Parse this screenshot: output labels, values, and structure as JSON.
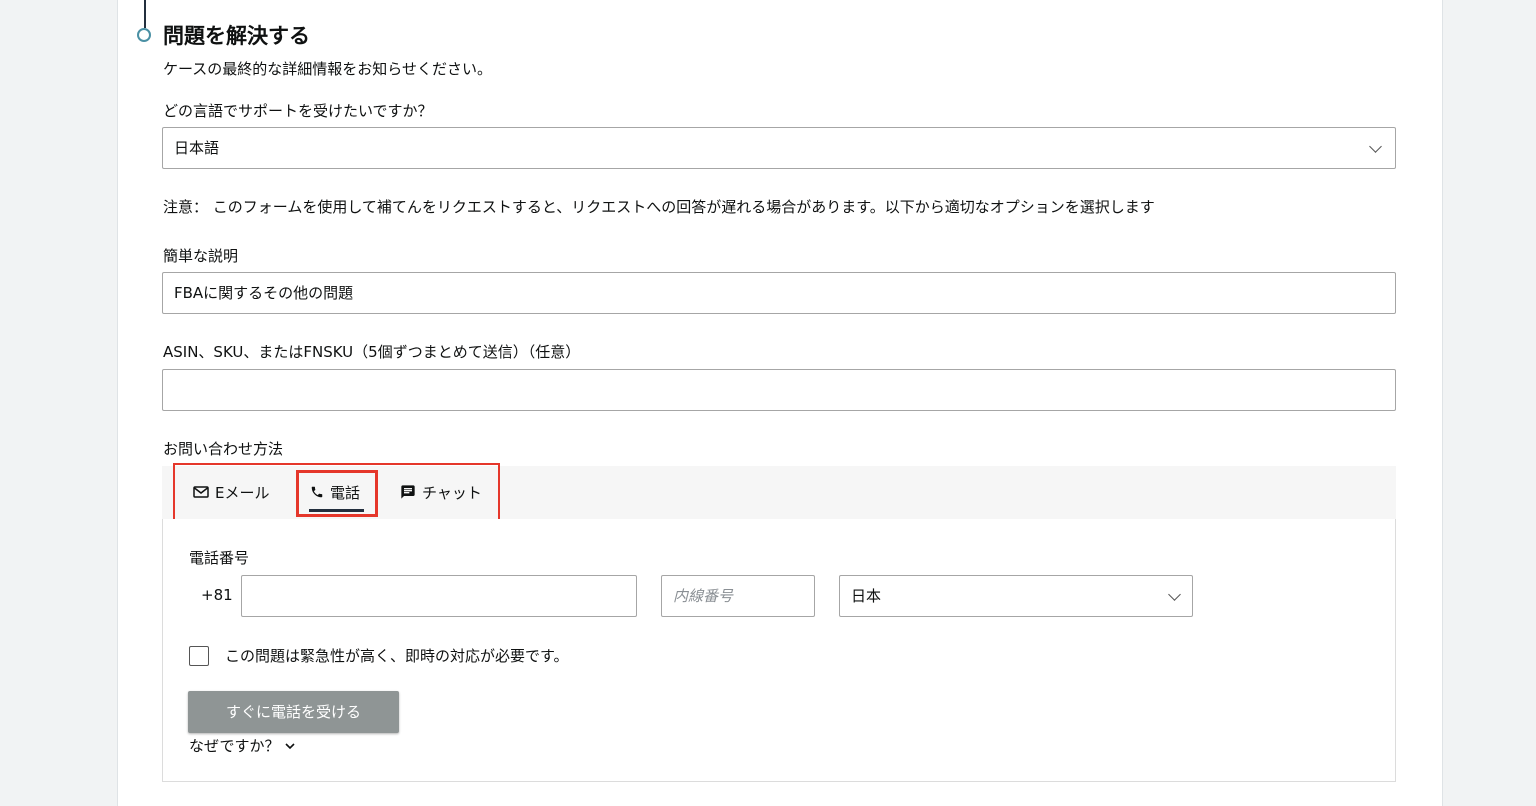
{
  "section": {
    "title": "問題を解決する",
    "subtitle": "ケースの最終的な詳細情報をお知らせください。"
  },
  "language": {
    "question": "どの言語でサポートを受けたいですか？",
    "selected": "日本語"
  },
  "notice": "注意： このフォームを使用して補てんをリクエストすると、リクエストへの回答が遅れる場合があります。以下から適切なオプションを選択します",
  "short_description": {
    "label": "簡単な説明",
    "value": "FBAに関するその他の問題"
  },
  "asin": {
    "label": "ASIN、SKU、またはFNSKU（5個ずつまとめて送信）（任意）",
    "value": ""
  },
  "contact": {
    "label": "お問い合わせ方法",
    "tabs": [
      {
        "label": "Eメール",
        "icon": "mail-icon",
        "selected": false
      },
      {
        "label": "電話",
        "icon": "phone-icon",
        "selected": true
      },
      {
        "label": "チャット",
        "icon": "chat-icon",
        "selected": false
      }
    ]
  },
  "phone": {
    "label": "電話番号",
    "prefix": "+81",
    "number": "",
    "extension_placeholder": "内線番号",
    "country": "日本",
    "urgent_label": "この問題は緊急性が高く、即時の対応が必要です。",
    "urgent_checked": false,
    "call_button": "すぐに電話を受ける",
    "why_link": "なぜですか？"
  },
  "colors": {
    "highlight": "#e5372b",
    "disabled_button": "#8f9595",
    "timeline_dot": "#4a90a4"
  }
}
